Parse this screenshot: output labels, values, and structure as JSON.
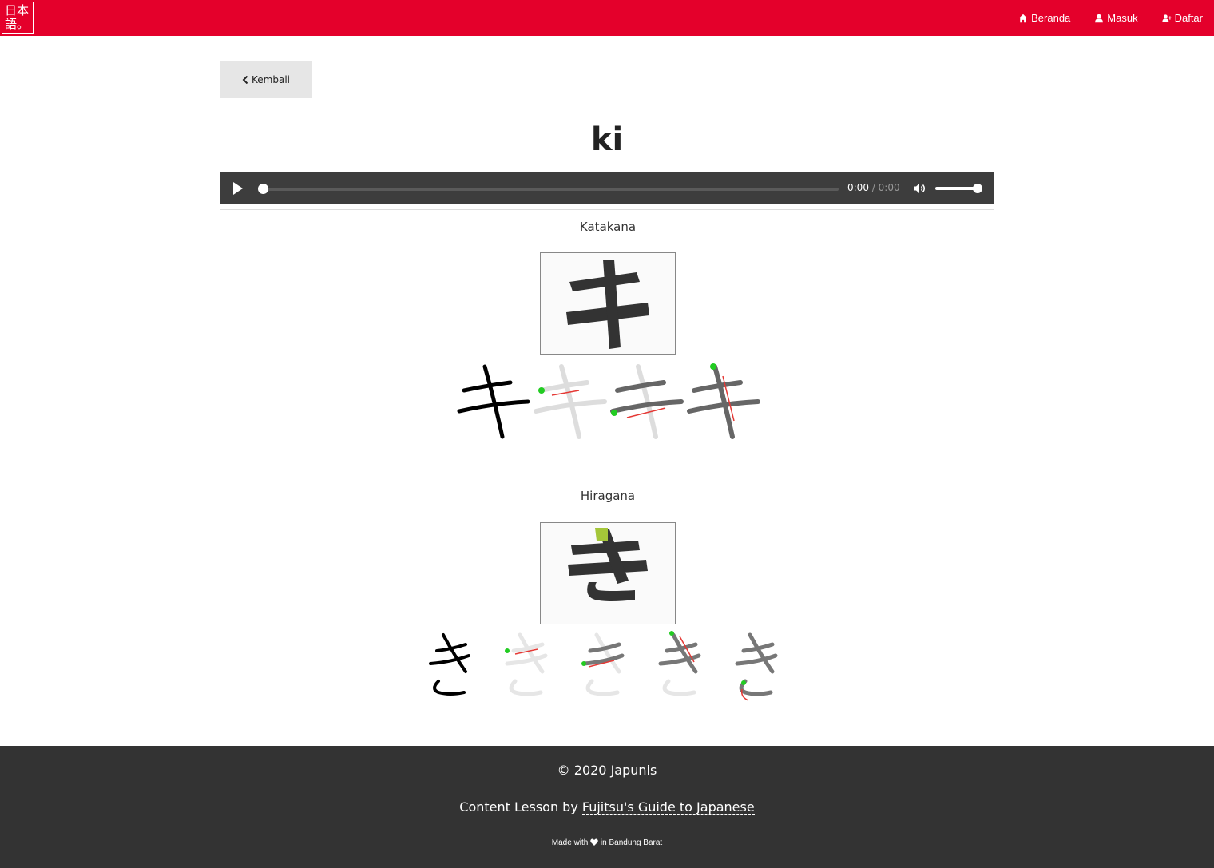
{
  "logo": {
    "line1": "日本",
    "line2": "語。"
  },
  "nav": {
    "home": "Beranda",
    "login": "Masuk",
    "register": "Daftar"
  },
  "back_label": "Kembali",
  "title": "ki",
  "audio": {
    "current_time": "0:00",
    "separator": "/",
    "duration": "0:00",
    "progress": 0,
    "volume": 1.0
  },
  "katakana": {
    "label": "Katakana",
    "char": "キ",
    "highlight_color": "#e00000"
  },
  "hiragana": {
    "label": "Hiragana",
    "char": "き",
    "first_stroke_color": "#a4c639"
  },
  "footer": {
    "copyright": "© 2020 Japunis",
    "lesson_prefix": "Content Lesson by ",
    "lesson_link": "Fujitsu's Guide to Japanese",
    "made_prefix": "Made with",
    "made_suffix": "in Bandung Barat"
  }
}
